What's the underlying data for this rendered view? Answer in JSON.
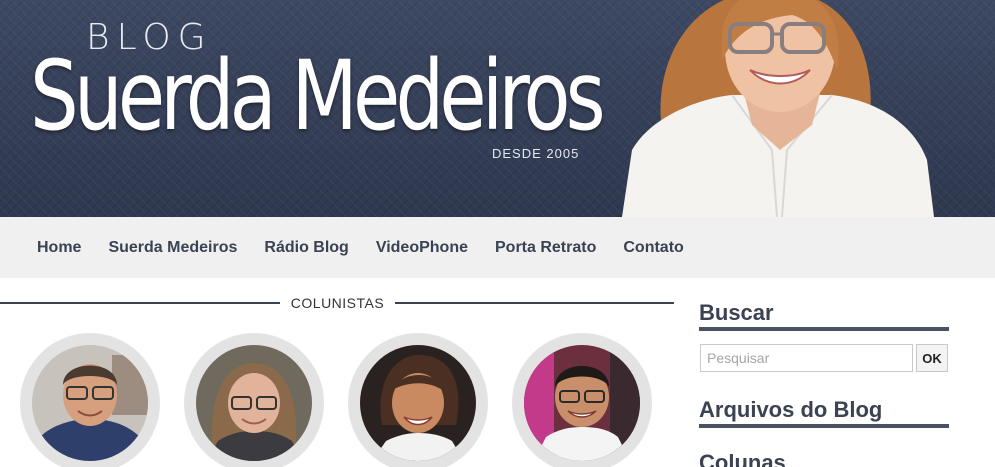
{
  "header": {
    "logo_small": "BLOG",
    "logo_name": "Suerda Medeiros",
    "logo_since": "DESDE 2005"
  },
  "nav": {
    "items": [
      "Home",
      "Suerda Medeiros",
      "Rádio Blog",
      "VideoPhone",
      "Porta Retrato",
      "Contato"
    ]
  },
  "main": {
    "section_label": "COLUNISTAS"
  },
  "sidebar": {
    "search_title": "Buscar",
    "search_placeholder": "Pesquisar",
    "search_button": "OK",
    "archive_title": "Arquivos do Blog",
    "columns_title": "Colunas"
  },
  "colors": {
    "banner": "#2f3a53",
    "nav_background": "#f0f0f0",
    "text_dark": "#3b4252"
  }
}
